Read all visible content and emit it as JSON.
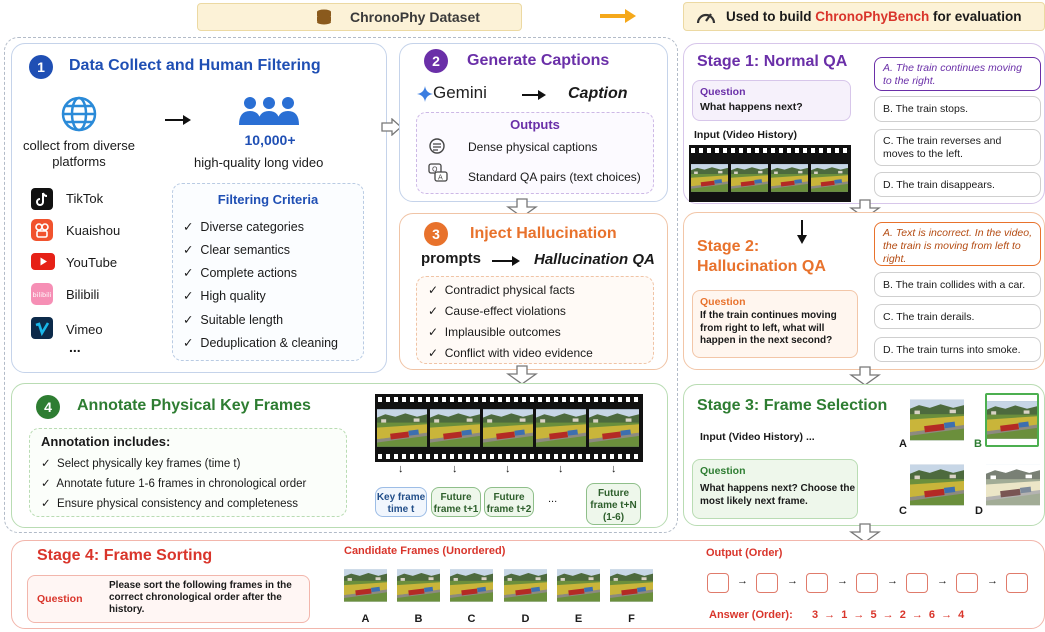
{
  "header": {
    "dataset_title": "ChronoPhy Dataset",
    "bench_prefix": "Used to build ",
    "bench_name": "ChronoPhyBench",
    "bench_suffix": " for evaluation"
  },
  "step1": {
    "num": "1",
    "title": "Data Collect and Human Filtering",
    "collect_text": "collect from diverse platforms",
    "count": "10,000+",
    "video_label": "high-quality long video",
    "platforms": [
      "TikTok",
      "Kuaishou",
      "YouTube",
      "Bilibili",
      "Vimeo"
    ],
    "ellipsis": "...",
    "filter_title": "Filtering Criteria",
    "criteria": [
      "Diverse categories",
      "Clear semantics",
      "Complete actions",
      "High quality",
      "Suitable length",
      "Deduplication & cleaning"
    ]
  },
  "step2": {
    "num": "2",
    "title": "Generate Captions",
    "model": "Gemini",
    "output": "Caption",
    "outputs_title": "Outputs",
    "outputs": [
      "Dense physical captions",
      "Standard QA pairs (text choices)"
    ]
  },
  "step3": {
    "num": "3",
    "title": "Inject Hallucination",
    "input": "prompts",
    "output": "Hallucination QA",
    "items": [
      "Contradict physical facts",
      "Cause-effect violations",
      "Implausible outcomes",
      "Conflict with video evidence"
    ]
  },
  "step4": {
    "num": "4",
    "title": "Annotate Physical Key Frames",
    "ann_title": "Annotation includes:",
    "items": [
      "Select physically key frames (time t)",
      "Annotate future 1-6 frames in chronological order",
      "Ensure physical consistency and completeness"
    ],
    "labels": [
      "Key frame time t",
      "Future frame t+1",
      "Future frame t+2",
      "...",
      "Future frame t+N (1-6)"
    ]
  },
  "stage1": {
    "title": "Stage 1: Normal QA",
    "q_label": "Question",
    "q_text": "What happens next?",
    "input_label": "Input (Video History)",
    "options": [
      "A. The train continues moving to the right.",
      "B. The train stops.",
      "C. The train reverses and moves to the left.",
      "D. The train disappears."
    ]
  },
  "stage2": {
    "title_1": "Stage 2:",
    "title_2": "Hallucination QA",
    "q_label": "Question",
    "q_text": "If the train continues moving from right to left, what will happen in the next second?",
    "options": [
      "A. Text is incorrect. In the video, the train is moving from left to right.",
      "B. The train collides with a car.",
      "C. The train derails.",
      "D. The train turns into smoke."
    ]
  },
  "stage3": {
    "title": "Stage 3: Frame Selection",
    "input_label": "Input (Video History) ...",
    "q_label": "Question",
    "q_text": "What happens next? Choose the most likely next frame.",
    "choices": [
      "A",
      "B",
      "C",
      "D"
    ]
  },
  "stage4": {
    "title": "Stage 4: Frame Sorting",
    "q_label": "Question",
    "q_text": "Please sort the following frames in the correct chronological order after the history.",
    "cand_title": "Candidate Frames (Unordered)",
    "frames": [
      "A",
      "B",
      "C",
      "D",
      "E",
      "F"
    ],
    "out_title": "Output (Order)",
    "answer_label": "Answer (Order):",
    "answer": "3 → 1 → 5 → 2 → 6 → 4"
  },
  "colors": {
    "blue": "#1f4fb4",
    "purple": "#6a2fa8",
    "orange": "#e8722c",
    "green": "#2e7d32",
    "red": "#d9352b"
  }
}
